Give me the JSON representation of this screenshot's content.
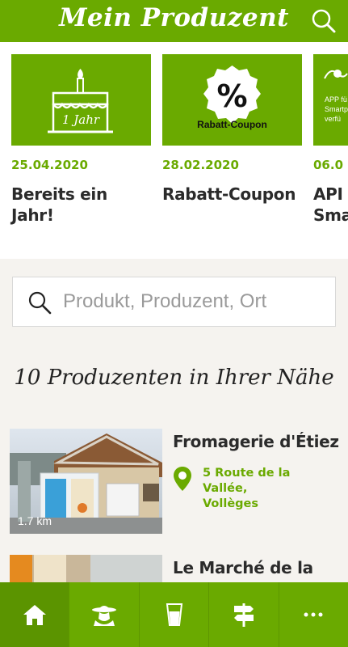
{
  "header": {
    "title": "Mein Produzent",
    "search_icon": "search-icon"
  },
  "news": [
    {
      "date": "25.04.2020",
      "title_line1": "Bereits ein",
      "title_line2": "Jahr!",
      "icon": "birthday-cake-icon",
      "badge_text": "1 Jahr"
    },
    {
      "date": "28.02.2020",
      "title_line1": "Rabatt-Coupon",
      "title_line2": "",
      "icon": "percent-coupon-icon",
      "badge_text": "Rabatt-Coupon"
    },
    {
      "date": "06.0",
      "title_line1": "API",
      "title_line2": "Sma",
      "icon": "smartphone-app-icon",
      "badge_line1": "APP fü",
      "badge_line2": "Smartp",
      "badge_line3": "verfü"
    }
  ],
  "search": {
    "placeholder": "Produkt, Produzent, Ort"
  },
  "section": {
    "title": "10 Produzenten in Ihrer Nähe"
  },
  "producers": [
    {
      "name": "Fromagerie d'Étiez",
      "address_line1": "5 Route de la Vallée,",
      "address_line2": "Vollèges",
      "distance": "1.7 km"
    },
    {
      "name": "Le Marché de la",
      "address_line1": "",
      "address_line2": "",
      "distance": ""
    }
  ],
  "nav": [
    {
      "icon": "home-icon",
      "active": true
    },
    {
      "icon": "producer-farmer-icon",
      "active": false
    },
    {
      "icon": "milk-glass-icon",
      "active": false
    },
    {
      "icon": "signpost-icon",
      "active": false
    },
    {
      "icon": "more-dots-icon",
      "active": false
    }
  ],
  "colors": {
    "brand": "#6aaa00",
    "brand_dark": "#5b9400",
    "text": "#2b2b2b",
    "background": "#f5f3ef"
  }
}
